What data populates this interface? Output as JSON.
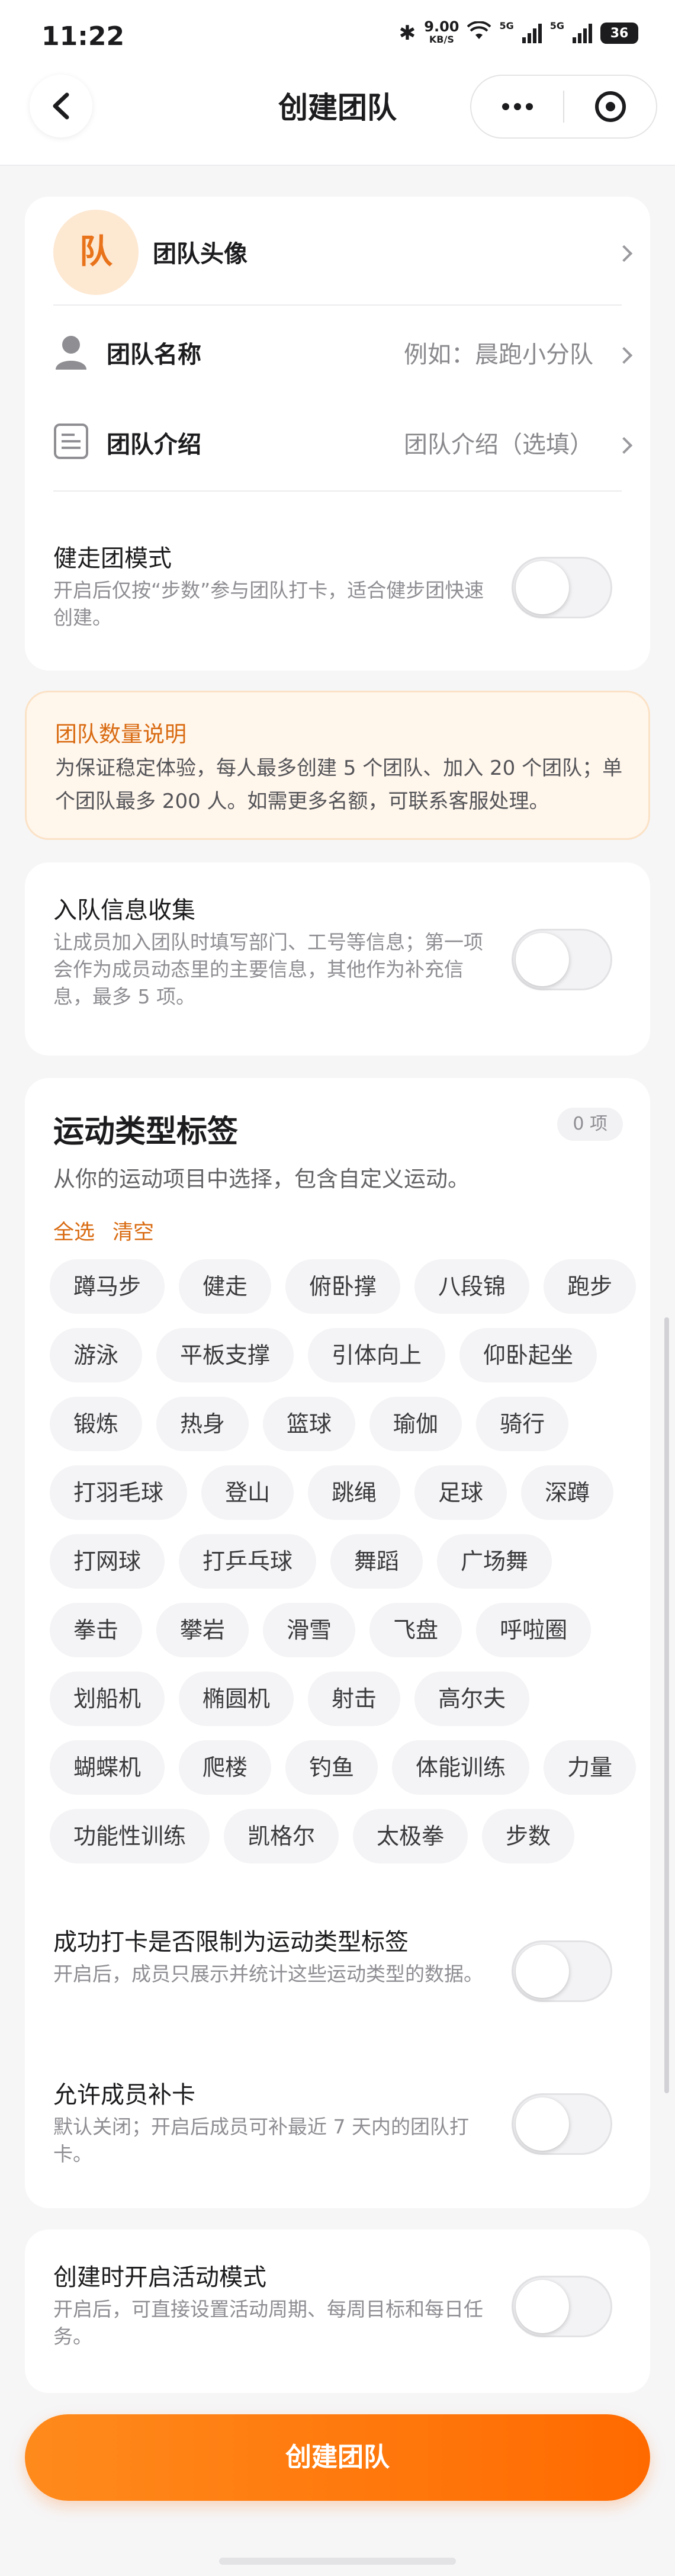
{
  "status_bar": {
    "time": "11:22",
    "speed_value": "9.00",
    "speed_unit": "KB/S",
    "signal1_label": "5G",
    "signal2_label": "5G",
    "battery": "36"
  },
  "nav": {
    "title": "创建团队"
  },
  "team_info": {
    "avatar_char": "队",
    "avatar_label": "团队头像",
    "name_label": "团队名称",
    "name_placeholder": "例如：晨跑小分队",
    "intro_label": "团队介绍",
    "intro_placeholder": "团队介绍（选填）",
    "walk_mode_title": "健走团模式",
    "walk_mode_desc": "开启后仅按“步数”参与团队打卡，适合健步团快速创建。",
    "walk_mode_on": false
  },
  "notice": {
    "title": "团队数量说明",
    "body": "为保证稳定体验，每人最多创建 5 个团队、加入 20 个团队；单个团队最多 200 人。如需更多名额，可联系客服处理。"
  },
  "join_info": {
    "title": "入队信息收集",
    "desc": "让成员加入团队时填写部门、工号等信息；第一项会作为成员动态里的主要信息，其他作为补充信息，最多 5 项。",
    "on": false
  },
  "sport_tags": {
    "title": "运动类型标签",
    "count_badge": "0 项",
    "subtitle": "从你的运动项目中选择，包含自定义运动。",
    "select_all": "全选",
    "clear": "清空",
    "tags": [
      "蹲马步",
      "健走",
      "俯卧撑",
      "八段锦",
      "跑步",
      "游泳",
      "平板支撑",
      "引体向上",
      "仰卧起坐",
      "锻炼",
      "热身",
      "篮球",
      "瑜伽",
      "骑行",
      "打羽毛球",
      "登山",
      "跳绳",
      "足球",
      "深蹲",
      "打网球",
      "打乒乓球",
      "舞蹈",
      "广场舞",
      "拳击",
      "攀岩",
      "滑雪",
      "飞盘",
      "呼啦圈",
      "划船机",
      "椭圆机",
      "射击",
      "高尔夫",
      "蝴蝶机",
      "爬楼",
      "钓鱼",
      "体能训练",
      "力量",
      "功能性训练",
      "凯格尔",
      "太极拳",
      "步数"
    ],
    "restrict_title": "成功打卡是否限制为运动类型标签",
    "restrict_desc": "开启后，成员只展示并统计这些运动类型的数据。",
    "restrict_on": false,
    "makeup_title": "允许成员补卡",
    "makeup_desc": "默认关闭；开启后成员可补最近 7 天内的团队打卡。",
    "makeup_on": false
  },
  "activity": {
    "title": "创建时开启活动模式",
    "desc": "开启后，可直接设置活动周期、每周目标和每日任务。",
    "on": false
  },
  "submit_label": "创建团队",
  "colors": {
    "accent": "#ff7a10",
    "accent_text": "#d96b12",
    "notice_bg": "#fff6ec"
  },
  "icons": {
    "back": "chevron-left-icon",
    "more": "more-dots-icon",
    "close": "target-circle-icon",
    "name": "person-icon",
    "intro": "document-icon",
    "arrow": "chevron-right-icon"
  }
}
